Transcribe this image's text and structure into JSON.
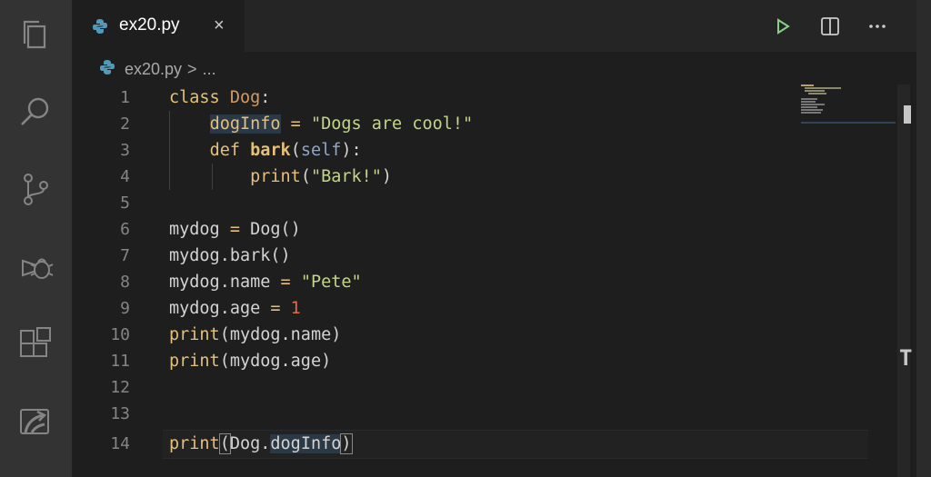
{
  "tab": {
    "filename": "ex20.py",
    "close": "×"
  },
  "breadcrumb": {
    "file": "ex20.py",
    "sep": ">",
    "more": "..."
  },
  "cursor_glyph": "T",
  "icons": [
    "explorer-icon",
    "search-icon",
    "source-control-icon",
    "debug-icon",
    "extensions-icon",
    "remote-icon",
    "run-icon",
    "split-editor-icon",
    "more-actions-icon",
    "python-file-icon",
    "close-icon"
  ],
  "colors": {
    "activity_bar": "#333333",
    "editor_bg": "#1e1e1e",
    "tab_bar": "#252526",
    "run_green": "#89d185"
  },
  "lines": [
    {
      "n": "1",
      "t": "class Dog:"
    },
    {
      "n": "2",
      "t": "    dogInfo = \"Dogs are cool!\""
    },
    {
      "n": "3",
      "t": "    def bark(self):"
    },
    {
      "n": "4",
      "t": "        print(\"Bark!\")"
    },
    {
      "n": "5",
      "t": ""
    },
    {
      "n": "6",
      "t": "mydog = Dog()"
    },
    {
      "n": "7",
      "t": "mydog.bark()"
    },
    {
      "n": "8",
      "t": "mydog.name = \"Pete\""
    },
    {
      "n": "9",
      "t": "mydog.age = 1"
    },
    {
      "n": "10",
      "t": "print(mydog.name)"
    },
    {
      "n": "11",
      "t": "print(mydog.age)"
    },
    {
      "n": "12",
      "t": ""
    },
    {
      "n": "13",
      "t": ""
    },
    {
      "n": "14",
      "t": "print(Dog.dogInfo)"
    }
  ]
}
